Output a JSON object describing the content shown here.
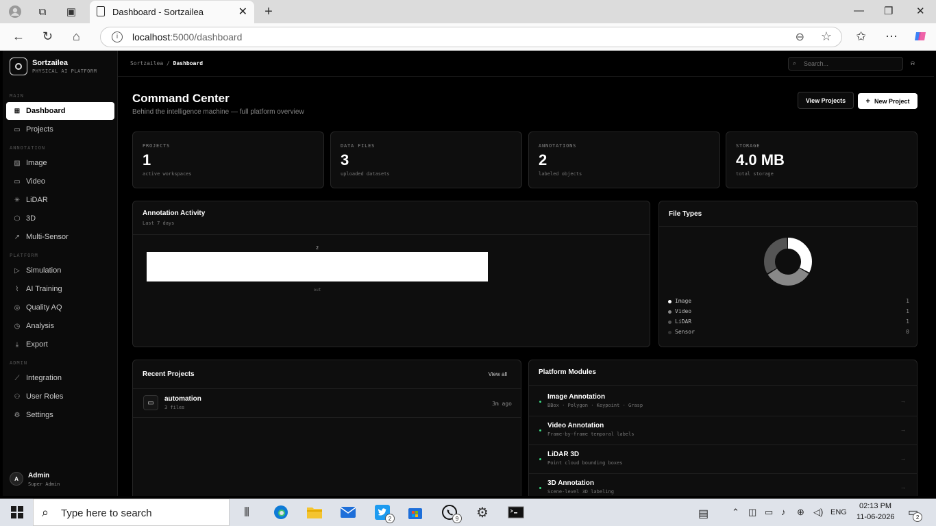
{
  "browser": {
    "tab_title": "Dashboard - Sortzailea",
    "url_host": "localhost",
    "url_rest": ":5000/dashboard"
  },
  "brand": {
    "name": "Sortzailea",
    "subtitle": "PHYSICAL AI PLATFORM"
  },
  "sidebar": {
    "sections": [
      {
        "label": "MAIN",
        "items": [
          {
            "label": "Dashboard",
            "icon": "grid-icon",
            "active": true
          },
          {
            "label": "Projects",
            "icon": "folder-icon"
          }
        ]
      },
      {
        "label": "ANNOTATION",
        "items": [
          {
            "label": "Image",
            "icon": "image-icon"
          },
          {
            "label": "Video",
            "icon": "video-icon"
          },
          {
            "label": "LiDAR",
            "icon": "lidar-icon"
          },
          {
            "label": "3D",
            "icon": "cube-icon"
          },
          {
            "label": "Multi-Sensor",
            "icon": "activity-icon"
          }
        ]
      },
      {
        "label": "PLATFORM",
        "items": [
          {
            "label": "Simulation",
            "icon": "play-icon"
          },
          {
            "label": "AI Training",
            "icon": "training-icon"
          },
          {
            "label": "Quality AQ",
            "icon": "check-circle-icon"
          },
          {
            "label": "Analysis",
            "icon": "clock-icon"
          },
          {
            "label": "Export",
            "icon": "download-icon"
          }
        ]
      },
      {
        "label": "ADMIN",
        "items": [
          {
            "label": "Integration",
            "icon": "link-icon"
          },
          {
            "label": "User Roles",
            "icon": "users-icon"
          },
          {
            "label": "Settings",
            "icon": "gear-icon"
          }
        ]
      }
    ],
    "user": {
      "initial": "A",
      "name": "Admin",
      "role": "Super Admin"
    }
  },
  "topbar": {
    "breadcrumb_root": "Sortzailea",
    "breadcrumb_sep": "/",
    "breadcrumb_current": "Dashboard",
    "search_placeholder": "Search..."
  },
  "header": {
    "title": "Command Center",
    "subtitle": "Behind the intelligence machine — full platform overview",
    "view_projects_label": "View Projects",
    "new_project_label": "New Project"
  },
  "stats": [
    {
      "label": "PROJECTS",
      "value": "1",
      "desc": "active workspaces"
    },
    {
      "label": "DATA FILES",
      "value": "3",
      "desc": "uploaded datasets"
    },
    {
      "label": "ANNOTATIONS",
      "value": "2",
      "desc": "labeled objects"
    },
    {
      "label": "STORAGE",
      "value": "4.0 MB",
      "desc": "total storage"
    }
  ],
  "activity": {
    "title": "Annotation Activity",
    "subtitle": "Last 7 days",
    "chart_data": {
      "type": "bar",
      "categories": [
        "out"
      ],
      "values": [
        2
      ],
      "ylim": [
        0,
        2
      ]
    }
  },
  "file_types": {
    "title": "File Types",
    "chart_data": {
      "type": "pie",
      "labels": [
        "Image",
        "Video",
        "LiDAR",
        "Sensor"
      ],
      "values": [
        1,
        1,
        1,
        0
      ],
      "colors": [
        "#ffffff",
        "#888888",
        "#555555",
        "#333333"
      ]
    }
  },
  "recent_projects": {
    "title": "Recent Projects",
    "view_all_label": "View all",
    "items": [
      {
        "name": "automation",
        "files": "3 files",
        "time": "3m ago"
      }
    ]
  },
  "modules": {
    "title": "Platform Modules",
    "items": [
      {
        "name": "Image Annotation",
        "desc": "BBox · Polygon · Keypoint · Grasp"
      },
      {
        "name": "Video Annotation",
        "desc": "Frame-by-frame temporal labels"
      },
      {
        "name": "LiDAR 3D",
        "desc": "Point cloud bounding boxes"
      },
      {
        "name": "3D Annotation",
        "desc": "Scene-level 3D labeling"
      }
    ]
  },
  "taskbar": {
    "search_placeholder": "Type here to search",
    "twitter_badge": "2",
    "whatsapp_badge": "9",
    "lang": "ENG",
    "time": "02:13 PM",
    "date": "11-06-2026",
    "notif_badge": "2"
  }
}
